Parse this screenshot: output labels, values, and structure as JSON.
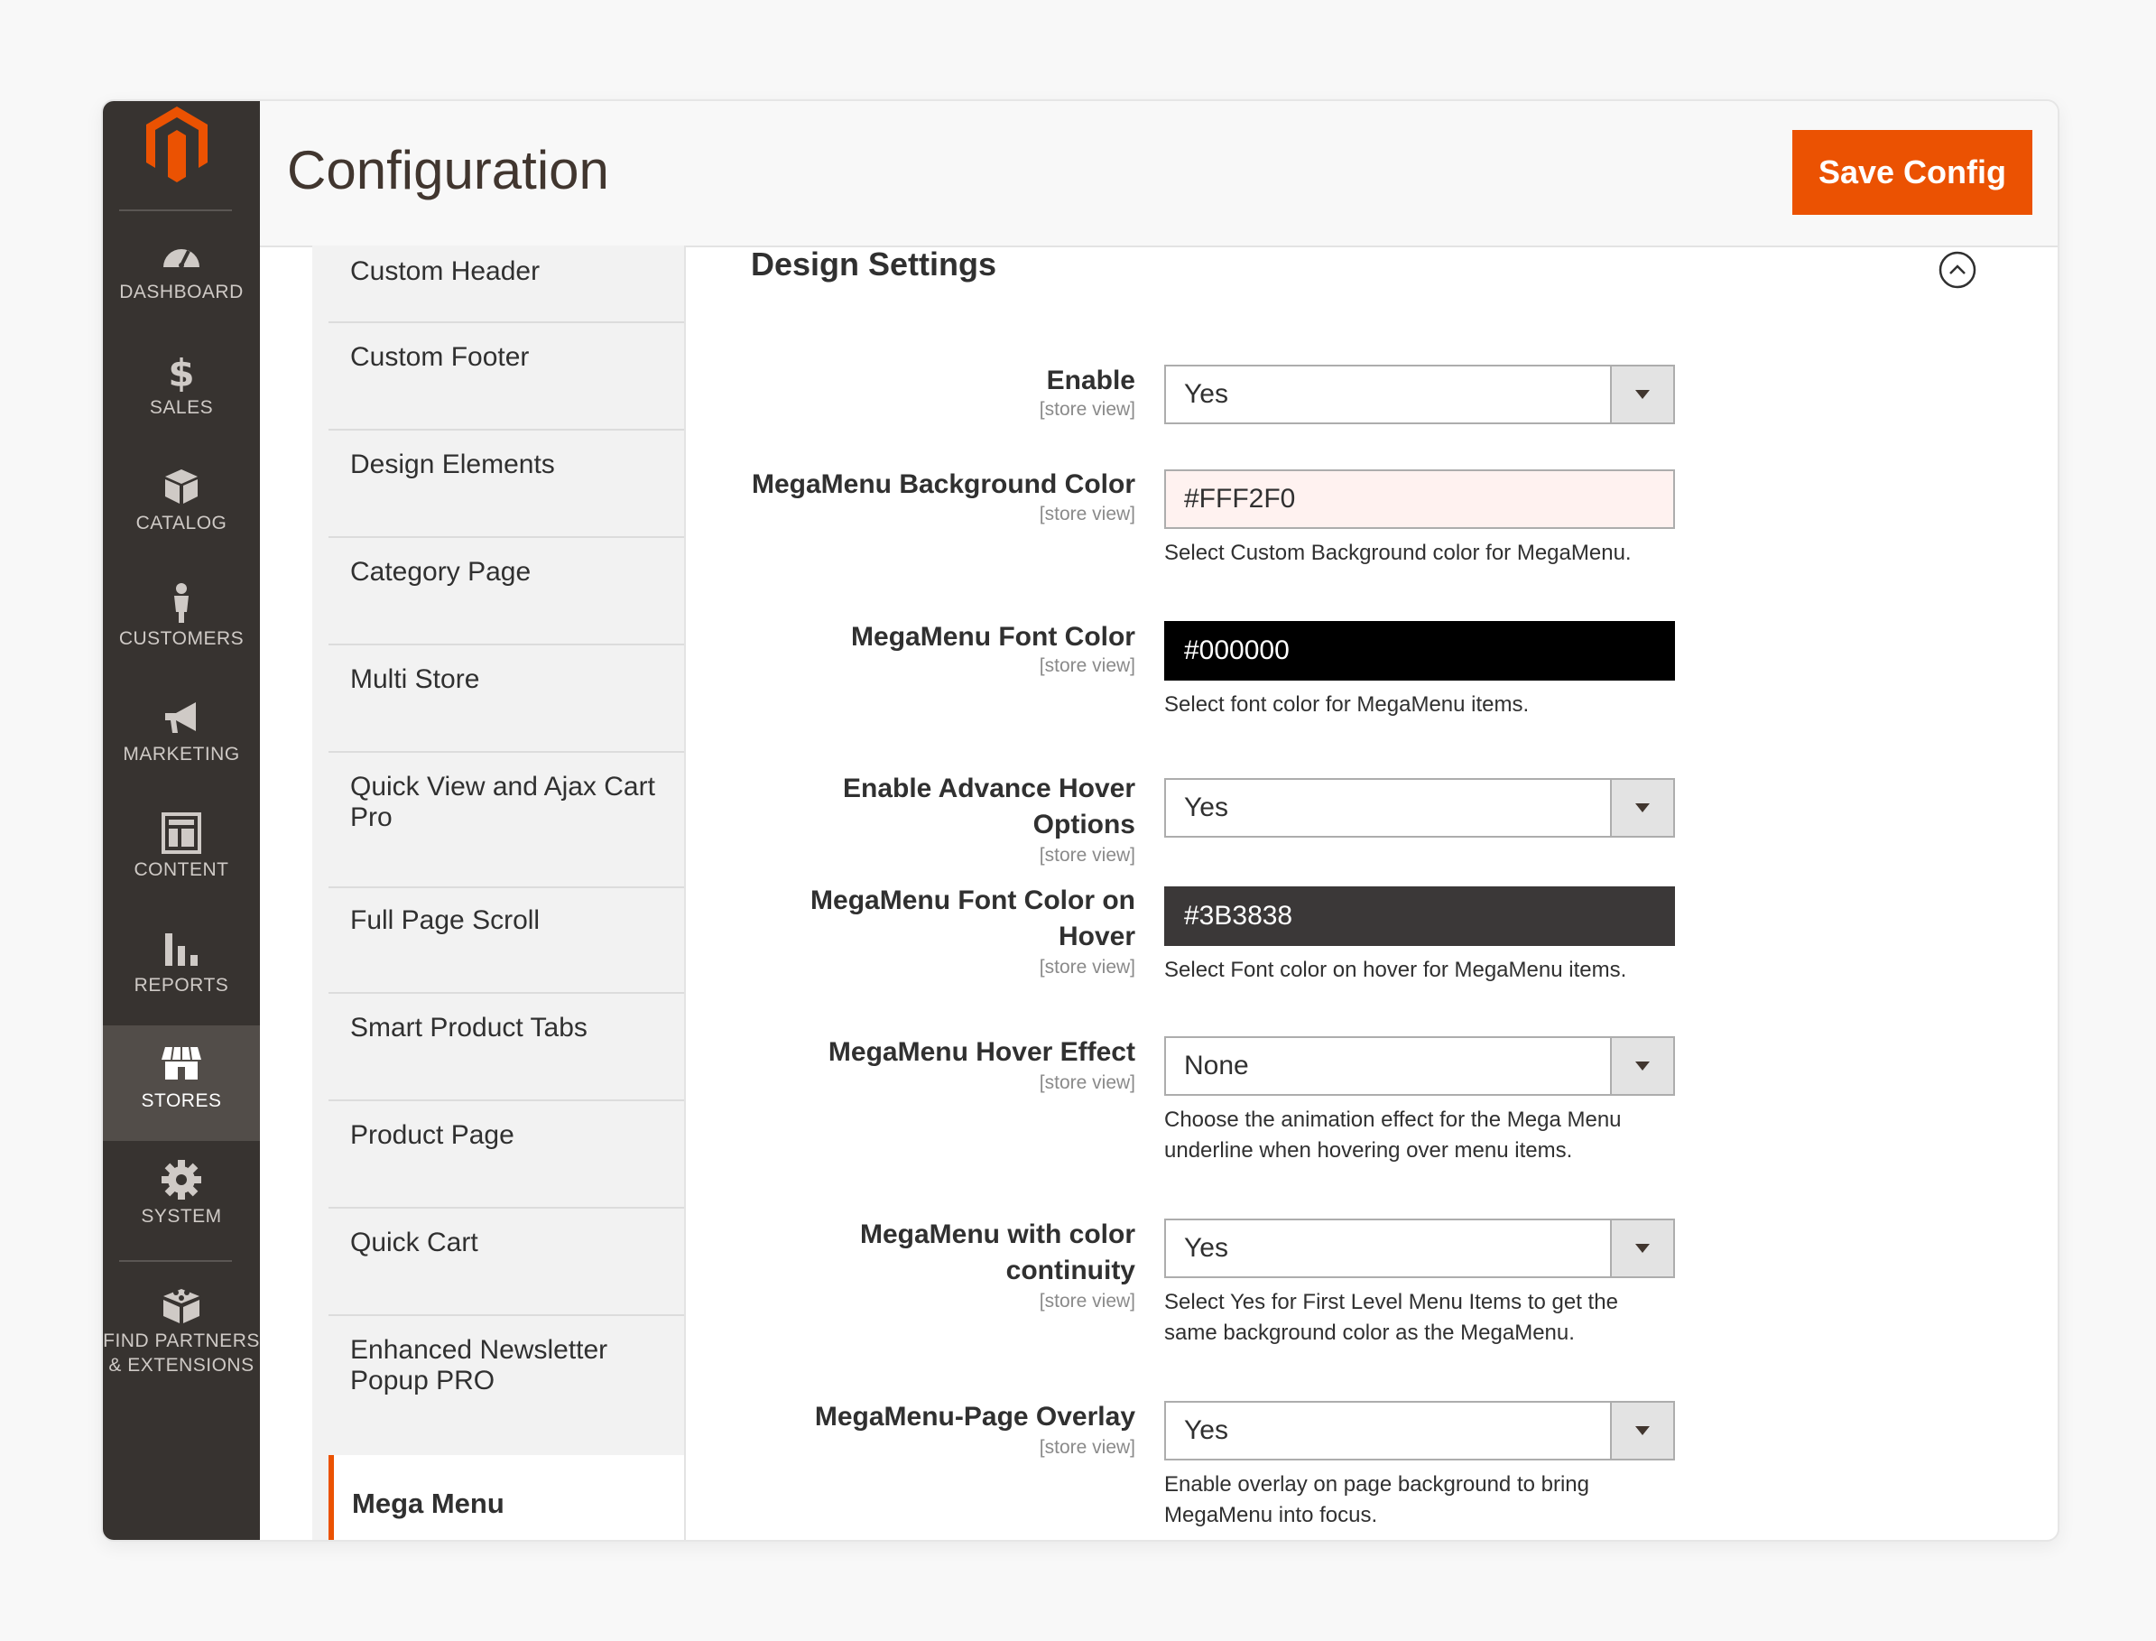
{
  "header": {
    "title": "Configuration",
    "save_label": "Save Config"
  },
  "admin_nav": {
    "items": [
      {
        "label": "DASHBOARD",
        "icon": "dashboard-icon"
      },
      {
        "label": "SALES",
        "icon": "dollar-icon"
      },
      {
        "label": "CATALOG",
        "icon": "box-icon"
      },
      {
        "label": "CUSTOMERS",
        "icon": "person-icon"
      },
      {
        "label": "MARKETING",
        "icon": "megaphone-icon"
      },
      {
        "label": "CONTENT",
        "icon": "layout-icon"
      },
      {
        "label": "REPORTS",
        "icon": "bar-chart-icon"
      },
      {
        "label": "STORES",
        "icon": "storefront-icon",
        "active": true
      },
      {
        "label": "SYSTEM",
        "icon": "gear-icon"
      },
      {
        "label": "FIND PARTNERS\n& EXTENSIONS",
        "icon": "blocks-icon"
      }
    ]
  },
  "config_tabs": {
    "items": [
      "Custom Header",
      "Custom Footer",
      "Design Elements",
      "Category Page",
      "Multi Store",
      "Quick View and Ajax Cart Pro",
      "Full Page Scroll",
      "Smart Product Tabs",
      "Product Page",
      "Quick Cart",
      "Enhanced Newsletter Popup PRO"
    ],
    "active": "Mega Menu"
  },
  "section": {
    "title": "Design Settings",
    "collapse_icon": "chevron-up-circle-icon",
    "scope_label": "[store view]",
    "fields": {
      "enable": {
        "label": "Enable",
        "value": "Yes"
      },
      "bg_color": {
        "label": "MegaMenu Background Color",
        "value": "#FFF2F0",
        "note": "Select Custom Background color for MegaMenu."
      },
      "font_color": {
        "label": "MegaMenu Font Color",
        "value": "#000000",
        "note": "Select font color for MegaMenu items."
      },
      "adv_hover": {
        "label_1": "Enable Advance Hover",
        "label_2": "Options",
        "value": "Yes"
      },
      "hover_color": {
        "label_1": "MegaMenu Font Color on",
        "label_2": "Hover",
        "value": "#3B3838",
        "note": "Select Font color on hover for MegaMenu items."
      },
      "hover_effect": {
        "label": "MegaMenu Hover Effect",
        "value": "None",
        "note_1": "Choose the animation effect for the Mega Menu",
        "note_2": "underline when hovering over menu items."
      },
      "color_continuity": {
        "label_1": "MegaMenu with color",
        "label_2": "continuity",
        "value": "Yes",
        "note_1": "Select Yes for First Level Menu Items to get the",
        "note_2": "same background color as the MegaMenu."
      },
      "page_overlay": {
        "label": "MegaMenu-Page Overlay",
        "value": "Yes",
        "note_1": "Enable overlay on page background to bring",
        "note_2": "MegaMenu into focus."
      }
    }
  },
  "colors": {
    "accent": "#eb5202",
    "nav_bg": "#373330",
    "bg_swatch": "#FFF2F0",
    "font_swatch": "#000000",
    "hover_swatch": "#3B3838"
  }
}
